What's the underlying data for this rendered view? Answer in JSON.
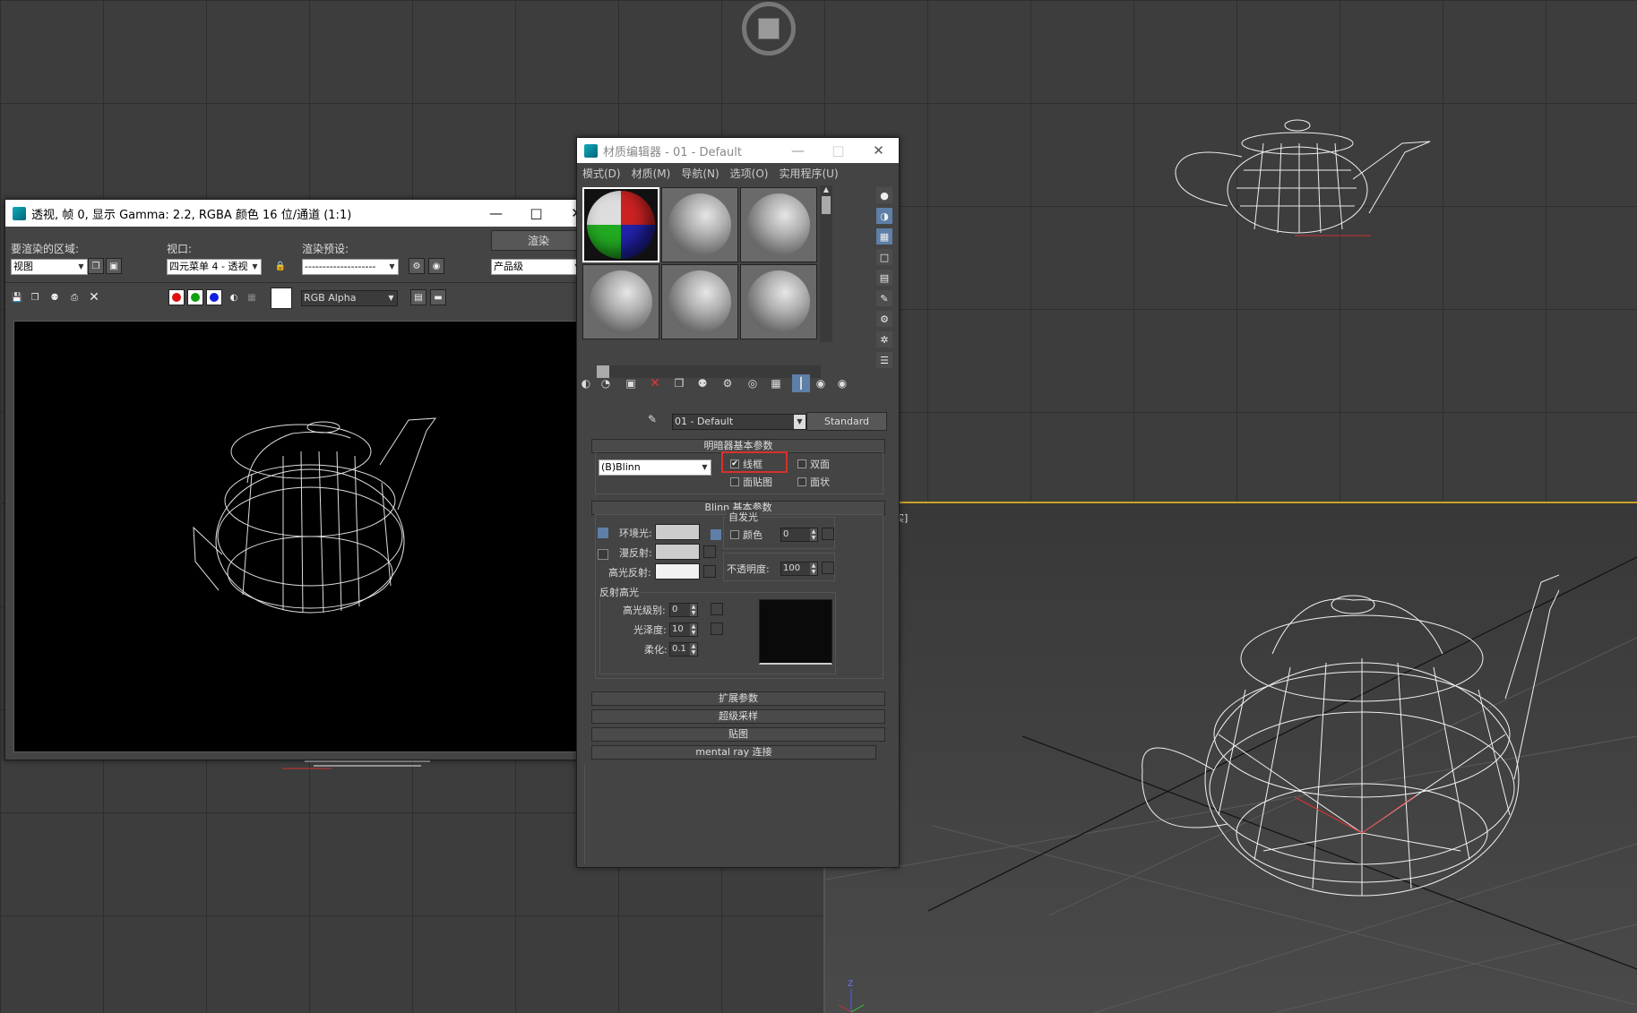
{
  "render_window": {
    "title": "透视, 帧 0, 显示 Gamma: 2.2, RGBA 颜色 16 位/通道 (1:1)",
    "area_label": "要渲染的区域:",
    "area_value": "视图",
    "viewport_label": "视口:",
    "viewport_value": "四元菜单 4 - 透视",
    "preset_label": "渲染预设:",
    "preset_value": "--------------------",
    "render_button": "渲染",
    "quality_value": "产品级",
    "channel_value": "RGB Alpha"
  },
  "material_editor": {
    "title": "材质编辑器 - 01 - Default",
    "menus": [
      "模式(D)",
      "材质(M)",
      "导航(N)",
      "选项(O)",
      "实用程序(U)"
    ],
    "material_name": "01 - Default",
    "material_type": "Standard",
    "shader_section": "明暗器基本参数",
    "shader_value": "(B)Blinn",
    "wire_label": "线框",
    "wire_checked": true,
    "two_sided_label": "双面",
    "face_map_label": "面贴图",
    "faceted_label": "面状",
    "blinn_section": "Blinn 基本参数",
    "self_illum_label": "自发光",
    "color_label": "颜色",
    "color_value": "0",
    "ambient_label": "环境光:",
    "diffuse_label": "漫反射:",
    "specular_label": "高光反射:",
    "opacity_label": "不透明度:",
    "opacity_value": "100",
    "spec_highlights_label": "反射高光",
    "spec_level_label": "高光级别:",
    "spec_level_value": "0",
    "glossiness_label": "光泽度:",
    "glossiness_value": "10",
    "soften_label": "柔化:",
    "soften_value": "0.1",
    "rollouts": [
      "扩展参数",
      "超级采样",
      "贴图",
      "mental ray 连接"
    ]
  },
  "viewport_label_fragment": "实]",
  "axis_label": "Z",
  "colors": {
    "highlight_box": "#d8312b",
    "viewport_bg": "#3d3d3d",
    "panel_bg": "#444444"
  }
}
